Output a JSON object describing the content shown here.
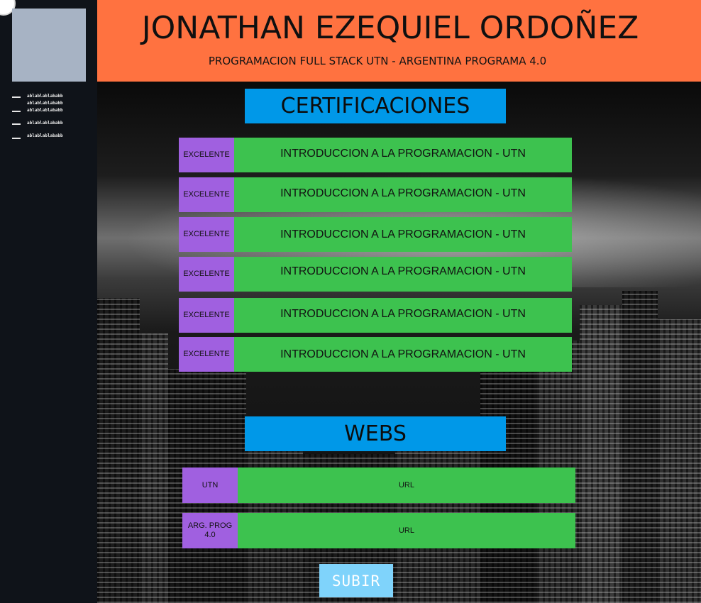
{
  "sidebar": {
    "items": [
      {
        "label": "ablablablababb"
      },
      {
        "label": "ablablablababb"
      },
      {
        "label": "ablablablababb"
      },
      {
        "label": ""
      },
      {
        "label": "ablablablababb"
      },
      {
        "label": ""
      },
      {
        "label": "ablablablababb"
      }
    ]
  },
  "header": {
    "title": "JONATHAN EZEQUIEL ORDOÑEZ",
    "subtitle": "PROGRAMACION FULL STACK UTN - ARGENTINA PROGRAMA 4.0"
  },
  "certificaciones": {
    "title": "CERTIFICACIONES",
    "rows": [
      {
        "tag": "EXCELENTE",
        "text": "INTRODUCCION A LA PROGRAMACION - UTN"
      },
      {
        "tag": "EXCELENTE",
        "text": "INTRODUCCION A LA PROGRAMACION - UTN"
      },
      {
        "tag": "EXCELENTE",
        "text": "INTRODUCCION A LA PROGRAMACION - UTN"
      },
      {
        "tag": "EXCELENTE",
        "text": "INTRODUCCION A LA PROGRAMACION - UTN"
      },
      {
        "tag": "EXCELENTE",
        "text": "INTRODUCCION A LA PROGRAMACION - UTN"
      },
      {
        "tag": "EXCELENTE",
        "text": "INTRODUCCION A LA PROGRAMACION - UTN"
      }
    ]
  },
  "webs": {
    "title": "WEBS",
    "rows": [
      {
        "tag": "UTN",
        "url": "URL"
      },
      {
        "tag": "ARG. PROG 4.0",
        "url": "URL"
      }
    ]
  },
  "subir_label": "SUBIR",
  "colors": {
    "header_bg": "#ff7240",
    "section_title_bg": "#0098e8",
    "tag_bg": "#a060e0",
    "row_bg": "#3dc24f",
    "button_bg": "#7fd3fb",
    "sidebar_bg": "#0f1319"
  }
}
